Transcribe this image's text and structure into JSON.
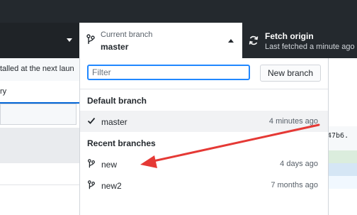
{
  "toolbar": {
    "current_branch_label": "Current branch",
    "current_branch_value": "master",
    "fetch_title": "Fetch origin",
    "fetch_subtitle": "Last fetched a minute ago"
  },
  "background": {
    "banner_text": "talled at the next laun",
    "tab_text": "ry",
    "commit_sha_fragment": "47b6."
  },
  "dropdown": {
    "filter_placeholder": "Filter",
    "new_branch_label": "New branch",
    "default_section": "Default branch",
    "recent_section": "Recent branches",
    "default_branches": [
      {
        "name": "master",
        "ago": "4 minutes ago",
        "icon": "check-icon"
      }
    ],
    "recent_branches": [
      {
        "name": "new",
        "ago": "4 days ago",
        "icon": "git-branch-icon"
      },
      {
        "name": "new2",
        "ago": "7 months ago",
        "icon": "git-branch-icon"
      }
    ]
  },
  "colors": {
    "toolbar_bg": "#24292e",
    "accent": "#2188ff",
    "annotation_arrow": "#e53935"
  }
}
